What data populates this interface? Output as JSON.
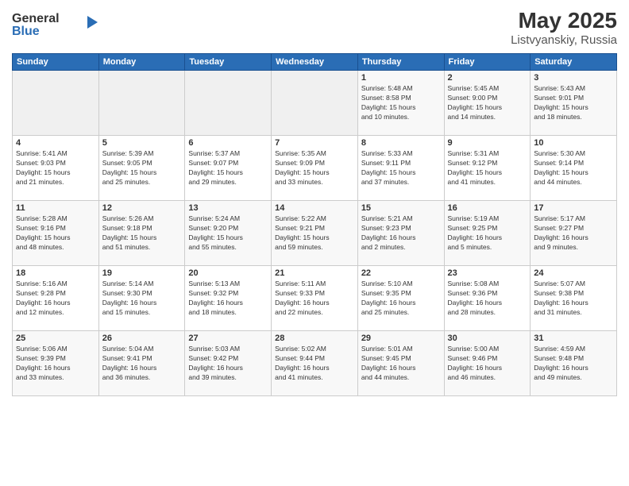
{
  "header": {
    "logo_general": "General",
    "logo_blue": "Blue",
    "month_year": "May 2025",
    "location": "Listvyanskiy, Russia"
  },
  "days_of_week": [
    "Sunday",
    "Monday",
    "Tuesday",
    "Wednesday",
    "Thursday",
    "Friday",
    "Saturday"
  ],
  "weeks": [
    [
      {
        "day": "",
        "info": ""
      },
      {
        "day": "",
        "info": ""
      },
      {
        "day": "",
        "info": ""
      },
      {
        "day": "",
        "info": ""
      },
      {
        "day": "1",
        "info": "Sunrise: 5:48 AM\nSunset: 8:58 PM\nDaylight: 15 hours\nand 10 minutes."
      },
      {
        "day": "2",
        "info": "Sunrise: 5:45 AM\nSunset: 9:00 PM\nDaylight: 15 hours\nand 14 minutes."
      },
      {
        "day": "3",
        "info": "Sunrise: 5:43 AM\nSunset: 9:01 PM\nDaylight: 15 hours\nand 18 minutes."
      }
    ],
    [
      {
        "day": "4",
        "info": "Sunrise: 5:41 AM\nSunset: 9:03 PM\nDaylight: 15 hours\nand 21 minutes."
      },
      {
        "day": "5",
        "info": "Sunrise: 5:39 AM\nSunset: 9:05 PM\nDaylight: 15 hours\nand 25 minutes."
      },
      {
        "day": "6",
        "info": "Sunrise: 5:37 AM\nSunset: 9:07 PM\nDaylight: 15 hours\nand 29 minutes."
      },
      {
        "day": "7",
        "info": "Sunrise: 5:35 AM\nSunset: 9:09 PM\nDaylight: 15 hours\nand 33 minutes."
      },
      {
        "day": "8",
        "info": "Sunrise: 5:33 AM\nSunset: 9:11 PM\nDaylight: 15 hours\nand 37 minutes."
      },
      {
        "day": "9",
        "info": "Sunrise: 5:31 AM\nSunset: 9:12 PM\nDaylight: 15 hours\nand 41 minutes."
      },
      {
        "day": "10",
        "info": "Sunrise: 5:30 AM\nSunset: 9:14 PM\nDaylight: 15 hours\nand 44 minutes."
      }
    ],
    [
      {
        "day": "11",
        "info": "Sunrise: 5:28 AM\nSunset: 9:16 PM\nDaylight: 15 hours\nand 48 minutes."
      },
      {
        "day": "12",
        "info": "Sunrise: 5:26 AM\nSunset: 9:18 PM\nDaylight: 15 hours\nand 51 minutes."
      },
      {
        "day": "13",
        "info": "Sunrise: 5:24 AM\nSunset: 9:20 PM\nDaylight: 15 hours\nand 55 minutes."
      },
      {
        "day": "14",
        "info": "Sunrise: 5:22 AM\nSunset: 9:21 PM\nDaylight: 15 hours\nand 59 minutes."
      },
      {
        "day": "15",
        "info": "Sunrise: 5:21 AM\nSunset: 9:23 PM\nDaylight: 16 hours\nand 2 minutes."
      },
      {
        "day": "16",
        "info": "Sunrise: 5:19 AM\nSunset: 9:25 PM\nDaylight: 16 hours\nand 5 minutes."
      },
      {
        "day": "17",
        "info": "Sunrise: 5:17 AM\nSunset: 9:27 PM\nDaylight: 16 hours\nand 9 minutes."
      }
    ],
    [
      {
        "day": "18",
        "info": "Sunrise: 5:16 AM\nSunset: 9:28 PM\nDaylight: 16 hours\nand 12 minutes."
      },
      {
        "day": "19",
        "info": "Sunrise: 5:14 AM\nSunset: 9:30 PM\nDaylight: 16 hours\nand 15 minutes."
      },
      {
        "day": "20",
        "info": "Sunrise: 5:13 AM\nSunset: 9:32 PM\nDaylight: 16 hours\nand 18 minutes."
      },
      {
        "day": "21",
        "info": "Sunrise: 5:11 AM\nSunset: 9:33 PM\nDaylight: 16 hours\nand 22 minutes."
      },
      {
        "day": "22",
        "info": "Sunrise: 5:10 AM\nSunset: 9:35 PM\nDaylight: 16 hours\nand 25 minutes."
      },
      {
        "day": "23",
        "info": "Sunrise: 5:08 AM\nSunset: 9:36 PM\nDaylight: 16 hours\nand 28 minutes."
      },
      {
        "day": "24",
        "info": "Sunrise: 5:07 AM\nSunset: 9:38 PM\nDaylight: 16 hours\nand 31 minutes."
      }
    ],
    [
      {
        "day": "25",
        "info": "Sunrise: 5:06 AM\nSunset: 9:39 PM\nDaylight: 16 hours\nand 33 minutes."
      },
      {
        "day": "26",
        "info": "Sunrise: 5:04 AM\nSunset: 9:41 PM\nDaylight: 16 hours\nand 36 minutes."
      },
      {
        "day": "27",
        "info": "Sunrise: 5:03 AM\nSunset: 9:42 PM\nDaylight: 16 hours\nand 39 minutes."
      },
      {
        "day": "28",
        "info": "Sunrise: 5:02 AM\nSunset: 9:44 PM\nDaylight: 16 hours\nand 41 minutes."
      },
      {
        "day": "29",
        "info": "Sunrise: 5:01 AM\nSunset: 9:45 PM\nDaylight: 16 hours\nand 44 minutes."
      },
      {
        "day": "30",
        "info": "Sunrise: 5:00 AM\nSunset: 9:46 PM\nDaylight: 16 hours\nand 46 minutes."
      },
      {
        "day": "31",
        "info": "Sunrise: 4:59 AM\nSunset: 9:48 PM\nDaylight: 16 hours\nand 49 minutes."
      }
    ]
  ]
}
